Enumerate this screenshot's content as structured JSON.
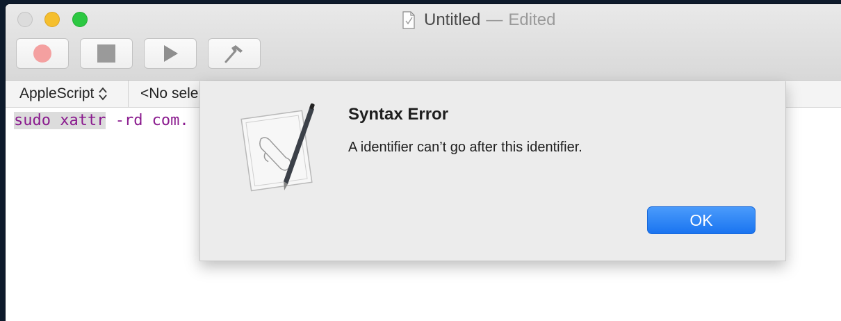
{
  "window": {
    "title": "Untitled",
    "title_separator": "—",
    "title_status": "Edited"
  },
  "toolbar": {
    "buttons": [
      {
        "name": "record",
        "icon": "record-icon"
      },
      {
        "name": "stop",
        "icon": "stop-icon"
      },
      {
        "name": "run",
        "icon": "play-icon"
      },
      {
        "name": "compile",
        "icon": "hammer-icon"
      }
    ]
  },
  "navbar": {
    "language": "AppleScript",
    "selection": "<No sele"
  },
  "editor": {
    "code_selected": "sudo xattr",
    "code_rest": " -rd com."
  },
  "dialog": {
    "title": "Syntax Error",
    "message": "A identifier can’t go after this identifier.",
    "ok_label": "OK",
    "icon": "script-editor-icon"
  },
  "colors": {
    "accent": "#1a74f0",
    "code_purple": "#8a1a8e",
    "record_red": "#f4a0a0"
  }
}
